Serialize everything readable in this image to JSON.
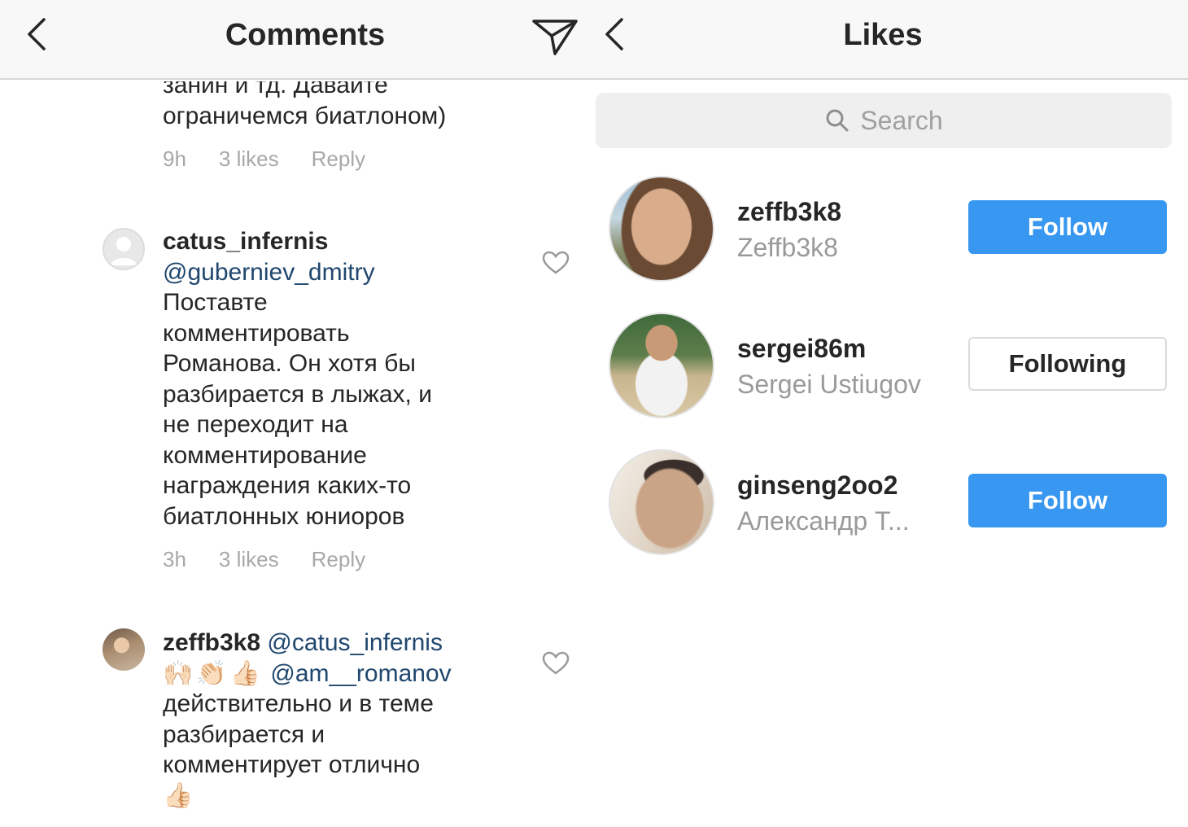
{
  "header": {
    "left_title": "Comments",
    "right_title": "Likes"
  },
  "comments": {
    "first_tail": {
      "text": "занин и тд. Давайте\nограничемся биатлоном)",
      "time": "9h",
      "likes": "3 likes",
      "reply": "Reply"
    },
    "items": [
      {
        "username": "catus_infernis",
        "mention": "@guberniev_dmitry",
        "text": "Поставте\nкомментировать\nРоманова. Он хотя бы\nразбирается в лыжах, и\nне переходит на\nкомментирование\nнаграждения каких-то\nбиатлонных юниоров",
        "time": "3h",
        "likes": "3 likes",
        "reply": "Reply"
      },
      {
        "username": "zeffb3k8",
        "mention": "@catus_infernis",
        "emojis": "🙌🏻👏🏻👍🏻",
        "mention2": "@am__romanov",
        "text": "действительно и в теме\nразбирается и\nкомментирует отлично",
        "trail_emoji": "👍🏻"
      }
    ]
  },
  "likes": {
    "search_placeholder": "Search",
    "users": [
      {
        "username": "zeffb3k8",
        "name": "Zeffb3k8",
        "button": "Follow",
        "state": "follow"
      },
      {
        "username": "sergei86m",
        "name": "Sergei Ustiugov",
        "button": "Following",
        "state": "following"
      },
      {
        "username": "ginseng2oo2",
        "name": "Александр Т...",
        "button": "Follow",
        "state": "follow"
      }
    ]
  },
  "colors": {
    "follow_blue": "#3897f0",
    "mention_blue": "#20476e",
    "meta_gray": "#a8a8a8"
  }
}
